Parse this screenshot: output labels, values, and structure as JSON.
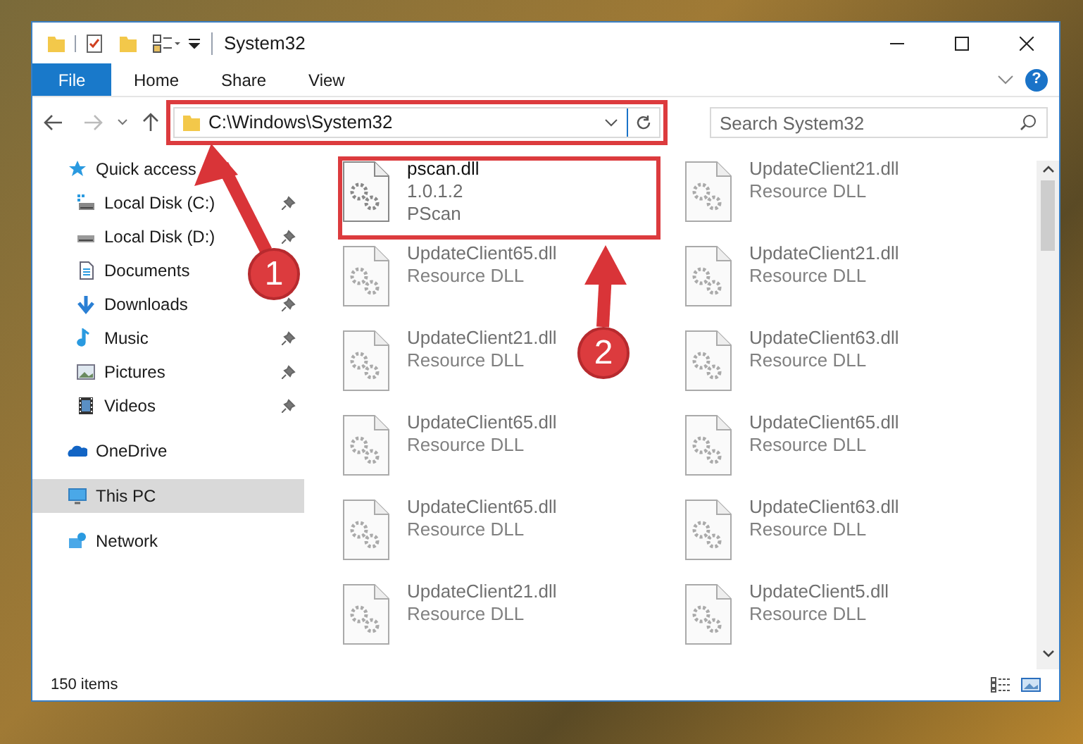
{
  "window": {
    "title": "System32"
  },
  "ribbon_tabs": [
    {
      "label": "File",
      "kind": "file"
    },
    {
      "label": "Home",
      "kind": "tab"
    },
    {
      "label": "Share",
      "kind": "tab"
    },
    {
      "label": "View",
      "kind": "tab"
    }
  ],
  "help_button": "?",
  "address_bar": {
    "path": "C:\\Windows\\System32",
    "highlighted": true
  },
  "search": {
    "placeholder": "Search System32"
  },
  "sidebar": {
    "items": [
      {
        "label": "Quick access",
        "selected": false,
        "children": [
          {
            "label": "Local Disk (C:)",
            "pinned": true,
            "selected": false
          },
          {
            "label": "Local Disk (D:)",
            "pinned": true,
            "selected": false
          },
          {
            "label": "Documents",
            "pinned": false,
            "selected": false
          },
          {
            "label": "Downloads",
            "pinned": true,
            "selected": false
          },
          {
            "label": "Music",
            "pinned": true,
            "selected": false
          },
          {
            "label": "Pictures",
            "pinned": true,
            "selected": false
          },
          {
            "label": "Videos",
            "pinned": true,
            "selected": false
          }
        ]
      },
      {
        "label": "OneDrive",
        "selected": false
      },
      {
        "label": "This PC",
        "selected": true
      },
      {
        "label": "Network",
        "selected": false
      }
    ]
  },
  "files": [
    {
      "name": "pscan.dll",
      "lines": [
        "1.0.1.2",
        "PScan"
      ],
      "blurred": false,
      "highlighted": true
    },
    {
      "name": "UpdateClient21.dll",
      "lines": [
        "Resource DLL"
      ],
      "blurred": true,
      "highlighted": false
    },
    {
      "name": "UpdateClient65.dll",
      "lines": [
        "Resource DLL"
      ],
      "blurred": true,
      "highlighted": false
    },
    {
      "name": "UpdateClient21.dll",
      "lines": [
        "Resource DLL"
      ],
      "blurred": true,
      "highlighted": false
    },
    {
      "name": "UpdateClient21.dll",
      "lines": [
        "Resource DLL"
      ],
      "blurred": true,
      "highlighted": false
    },
    {
      "name": "UpdateClient63.dll",
      "lines": [
        "Resource DLL"
      ],
      "blurred": true,
      "highlighted": false
    },
    {
      "name": "UpdateClient65.dll",
      "lines": [
        "Resource DLL"
      ],
      "blurred": true,
      "highlighted": false
    },
    {
      "name": "UpdateClient65.dll",
      "lines": [
        "Resource DLL"
      ],
      "blurred": true,
      "highlighted": false
    },
    {
      "name": "UpdateClient65.dll",
      "lines": [
        "Resource DLL"
      ],
      "blurred": true,
      "highlighted": false
    },
    {
      "name": "UpdateClient63.dll",
      "lines": [
        "Resource DLL"
      ],
      "blurred": true,
      "highlighted": false
    },
    {
      "name": "UpdateClient21.dll",
      "lines": [
        "Resource DLL"
      ],
      "blurred": true,
      "highlighted": false
    },
    {
      "name": "UpdateClient5.dll",
      "lines": [
        "Resource DLL"
      ],
      "blurred": true,
      "highlighted": false
    }
  ],
  "status_bar": {
    "item_count": "150 items"
  },
  "annotations": [
    {
      "number": "1"
    },
    {
      "number": "2"
    }
  ]
}
